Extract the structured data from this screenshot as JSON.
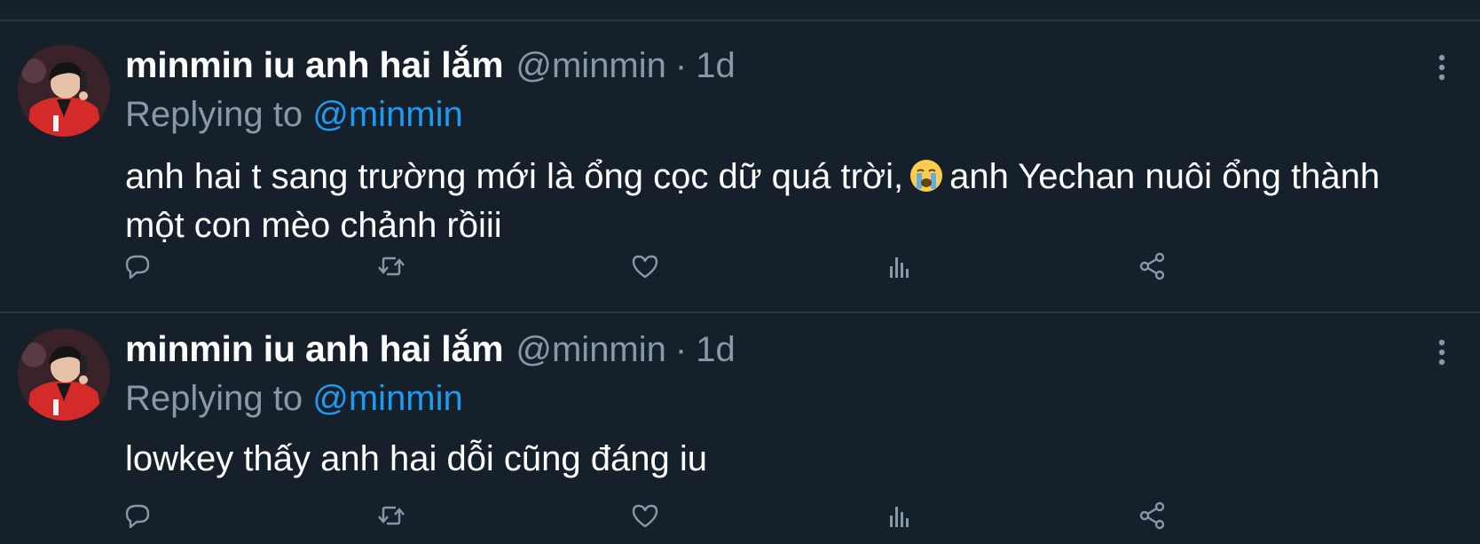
{
  "tweets": [
    {
      "display_name": "minmin iu anh hai lắm",
      "handle": "@minmin",
      "separator": "·",
      "time": "1d",
      "replying_prefix": "Replying to",
      "replying_to": "@minmin",
      "text_before_emoji": "anh hai t sang trường mới là ổng cọc dữ quá trời,",
      "emoji": "loudly-crying-face",
      "text_after_emoji": "anh Yechan nuôi ổng thành một con mèo chảnh rồiii",
      "avatar": "avatar-image",
      "actions": [
        "reply-icon",
        "retweet-icon",
        "like-icon",
        "analytics-icon",
        "share-icon"
      ]
    },
    {
      "display_name": "minmin iu anh hai lắm",
      "handle": "@minmin",
      "separator": "·",
      "time": "1d",
      "replying_prefix": "Replying to",
      "replying_to": "@minmin",
      "text": "lowkey thấy anh hai dỗi cũng đáng iu",
      "avatar": "avatar-image",
      "actions": [
        "reply-icon",
        "retweet-icon",
        "like-icon",
        "analytics-icon",
        "share-icon"
      ]
    }
  ],
  "colors": {
    "background": "#15202b",
    "divider": "#2b3640",
    "primary_text": "#ffffff",
    "secondary_text": "#8899a6",
    "accent": "#1d9bf0"
  }
}
